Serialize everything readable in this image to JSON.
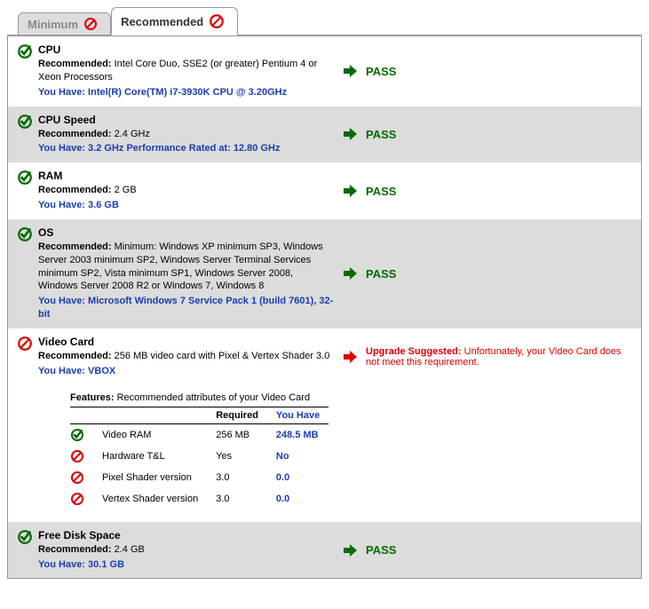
{
  "tabs": {
    "minimum_label": "Minimum",
    "recommended_label": "Recommended"
  },
  "items": [
    {
      "key": "cpu",
      "title": "CPU",
      "rec_label": "Recommended:",
      "recommended": "Intel Core Duo, SSE2 (or greater) Pentium 4 or Xeon Processors",
      "have_label": "You Have:",
      "have": "Intel(R) Core(TM) i7-3930K CPU @ 3.20GHz",
      "status": "pass",
      "status_text": "PASS",
      "alt": false
    },
    {
      "key": "cpu_speed",
      "title": "CPU Speed",
      "rec_label": "Recommended:",
      "recommended": "2.4 GHz",
      "have_label": "You Have:",
      "have": "3.2 GHz Performance Rated at: 12.80 GHz",
      "status": "pass",
      "status_text": "PASS",
      "alt": true
    },
    {
      "key": "ram",
      "title": "RAM",
      "rec_label": "Recommended:",
      "recommended": "2 GB",
      "have_label": "You Have:",
      "have": "3.6 GB",
      "status": "pass",
      "status_text": "PASS",
      "alt": false
    },
    {
      "key": "os",
      "title": "OS",
      "rec_label": "Recommended:",
      "recommended": "Minimum: Windows XP minimum SP3, Windows Server 2003 minimum SP2, Windows Server Terminal Services minimum SP2, Vista minimum SP1, Windows Server 2008, Windows Server 2008 R2 or Windows 7, Windows 8",
      "have_label": "You Have:",
      "have": "Microsoft Windows 7 Service Pack 1 (build 7601), 32-bit",
      "status": "pass",
      "status_text": "PASS",
      "alt": true
    },
    {
      "key": "video",
      "title": "Video Card",
      "rec_label": "Recommended:",
      "recommended": "256 MB video card with Pixel & Vertex Shader 3.0",
      "have_label": "You Have:",
      "have": "VBOX",
      "status": "fail",
      "status_title": "Upgrade Suggested:",
      "status_text": "Unfortunately, your Video Card does not meet this requirement.",
      "alt": false
    },
    {
      "key": "disk",
      "title": "Free Disk Space",
      "rec_label": "Recommended:",
      "recommended": "2.4 GB",
      "have_label": "You Have:",
      "have": "30.1 GB",
      "status": "pass",
      "status_text": "PASS",
      "alt": true
    }
  ],
  "features": {
    "label": "Features:",
    "desc": "Recommended attributes of your Video Card",
    "col_required": "Required",
    "col_have": "You Have",
    "rows": [
      {
        "status": "pass",
        "name": "Video RAM",
        "required": "256 MB",
        "have": "248.5 MB"
      },
      {
        "status": "fail",
        "name": "Hardware T&L",
        "required": "Yes",
        "have": "No"
      },
      {
        "status": "fail",
        "name": "Pixel Shader version",
        "required": "3.0",
        "have": "0.0"
      },
      {
        "status": "fail",
        "name": "Vertex Shader version",
        "required": "3.0",
        "have": "0.0"
      }
    ]
  }
}
